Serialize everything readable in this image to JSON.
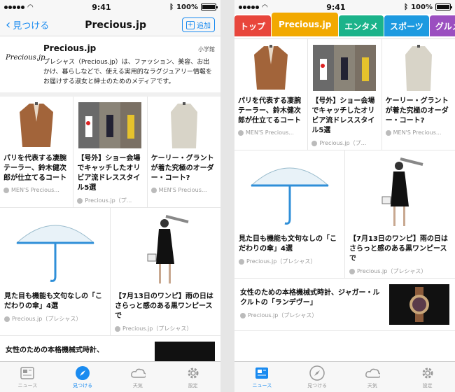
{
  "status": {
    "time": "9:41",
    "battery": "100%"
  },
  "left": {
    "nav": {
      "back": "見つける",
      "title": "Precious.jp",
      "add": "追加"
    },
    "publisher": {
      "logo": "Precious.jp",
      "name": "Precious.jp",
      "tag": "小学館",
      "desc": "プレシャス（Precious.jp）は、ファッション、美容、お出かけ、暮らしなどで、使える実用的なラグジュアリー情報をお届けする淑女と紳士のためのメディアです。"
    },
    "row1": [
      {
        "title": "パリを代表する凄腕テーラー、鈴木健次郎が仕立てるコート",
        "source": "MEN'S Precious..."
      },
      {
        "title": "【号外】ショー会場でキャッチしたオリビア流ドレススタイル5選",
        "source": "Precious.jp（プ..."
      },
      {
        "title": "ケーリー・グラントが着た究極のオーダー・コート?",
        "source": "MEN'S Precious..."
      }
    ],
    "row2": [
      {
        "title": "見た目も機能も文句なしの「こだわりの傘」4選",
        "source": "Precious.jp（プレシャス）"
      },
      {
        "title": "【7月13日のワンピ】雨の日はさらっと感のある黒ワンピースで",
        "source": "Precious.jp（プレシャス）"
      }
    ],
    "row3": {
      "title": "女性のための本格機械式時計、"
    }
  },
  "right": {
    "categories": [
      {
        "label": "トップ",
        "color": "#e8463c"
      },
      {
        "label": "Precious.jp",
        "color": "#f2a900"
      },
      {
        "label": "エンタメ",
        "color": "#1bb38a"
      },
      {
        "label": "スポーツ",
        "color": "#1d9ae0"
      },
      {
        "label": "グルメ",
        "color": "#9b4fc0"
      }
    ],
    "row1": [
      {
        "title": "パリを代表する凄腕テーラー、鈴木健次郎が仕立てるコート",
        "source": "MEN'S Precious..."
      },
      {
        "title": "【号外】ショー会場でキャッチしたオリビア流ドレススタイル5選",
        "source": "Precious.jp（プ..."
      },
      {
        "title": "ケーリー・グラントが着た究極のオーダー・コート?",
        "source": "MEN'S Precious..."
      }
    ],
    "row2": [
      {
        "title": "見た目も機能も文句なしの「こだわりの傘」4選",
        "source": "Precious.jp（プレシャス）"
      },
      {
        "title": "【7月13日のワンピ】雨の日はさらっと感のある黒ワンピースで",
        "source": "Precious.jp（プレシャス）"
      }
    ],
    "row3": {
      "title": "女性のための本格機械式時計、ジャガー・ルクルトの「ランデヴー」",
      "source": "Precious.jp（プレシャス）"
    }
  },
  "tabs": [
    "ニュース",
    "見つける",
    "天気",
    "設定"
  ],
  "colors": {
    "accent": "#1a8bf0"
  }
}
